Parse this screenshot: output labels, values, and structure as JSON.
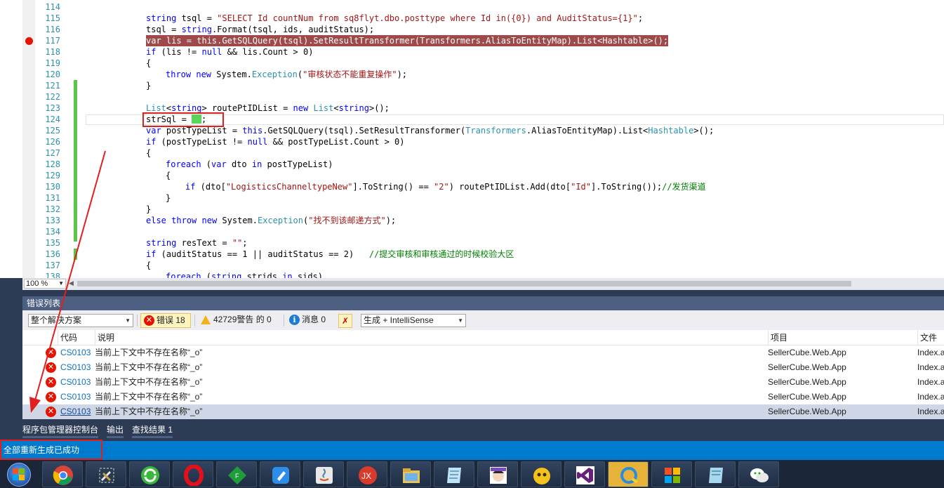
{
  "editor": {
    "line_numbers": [
      "114",
      "115",
      "116",
      "117",
      "118",
      "119",
      "120",
      "121",
      "122",
      "123",
      "124",
      "125",
      "126",
      "127",
      "128",
      "129",
      "130",
      "131",
      "132",
      "133",
      "134",
      "135",
      "136",
      "137",
      "138"
    ],
    "zoom": "100 %"
  },
  "code": {
    "l115": {
      "a": "string",
      "b": " tsql = ",
      "c": "\"SELECT Id countNum from sq8flyt.dbo.posttype where Id in({0}) and AuditStatus={1}\"",
      "d": ";"
    },
    "l116": {
      "a": "tsql = ",
      "b": "string",
      "c": ".Format(tsql, ids, auditStatus);"
    },
    "l117": "var lis = this.GetSQLQuery(tsql).SetResultTransformer(Transformers.AliasToEntityMap).List<Hashtable>();",
    "l118": {
      "a": "if",
      "b": " (lis != ",
      "c": "null",
      "d": " && lis.Count > 0)"
    },
    "l119": "{",
    "l120": {
      "a": "throw",
      "b": " ",
      "c": "new",
      "d": " System.",
      "e": "Exception",
      "f": "(",
      "g": "\"审核状态不能重复操作\"",
      "h": ");"
    },
    "l121": "}",
    "l123": {
      "a": "List",
      "b": "<",
      "c": "string",
      "d": "> routePtIDList = ",
      "e": "new",
      "f": " ",
      "g": "List",
      "h": "<",
      "i": "string",
      "j": ">();"
    },
    "l124": {
      "a": "strSql = ",
      "b": ";"
    },
    "l125": {
      "a": "var",
      "b": " postTypeList = ",
      "c": "this",
      "d": ".GetSQLQuery(tsql).SetResultTransformer(",
      "e": "Transformers",
      "f": ".AliasToEntityMap).List<",
      "g": "Hashtable",
      "h": ">();"
    },
    "l126": {
      "a": "if",
      "b": " (postTypeList != ",
      "c": "null",
      "d": " && postTypeList.Count > 0)"
    },
    "l127": "{",
    "l128": {
      "a": "foreach",
      "b": " (",
      "c": "var",
      "d": " dto ",
      "e": "in",
      "f": " postTypeList)"
    },
    "l129": "{",
    "l130": {
      "a": "if",
      "b": " (dto[",
      "c": "\"LogisticsChanneltypeNew\"",
      "d": "].ToString() == ",
      "e": "\"2\"",
      "f": ") routePtIDList.Add(dto[",
      "g": "\"Id\"",
      "h": "].ToString());",
      "i": "//发货渠道"
    },
    "l131": "}",
    "l132": "}",
    "l133": {
      "a": "else",
      "b": " ",
      "c": "throw",
      "d": " ",
      "e": "new",
      "f": " System.",
      "g": "Exception",
      "h": "(",
      "i": "\"找不到该邮递方式\"",
      "j": ");"
    },
    "l135": {
      "a": "string",
      "b": " resText = ",
      "c": "\"\"",
      "d": ";"
    },
    "l136": {
      "a": "if",
      "b": " (auditStatus == 1 || auditStatus == 2)   ",
      "c": "//提交审核和审核通过的时候校验大区"
    },
    "l137": "{",
    "l138": {
      "a": "foreach",
      "b": " (",
      "c": "string",
      "d": " strids ",
      "e": "in",
      "f": " sids)"
    }
  },
  "error_list": {
    "title": "错误列表",
    "scope": "整个解决方案",
    "errors_label": "错误 18",
    "warnings_label": "42729警告 的 0",
    "messages_label": "消息 0",
    "build_filter": "生成 + IntelliSense",
    "columns": {
      "code": "代码",
      "desc": "说明",
      "project": "项目",
      "file": "文件"
    },
    "rows": [
      {
        "code": "CS0103",
        "desc": "当前上下文中不存在名称“_o”",
        "project": "SellerCube.Web.App",
        "file": "Index.a"
      },
      {
        "code": "CS0103",
        "desc": "当前上下文中不存在名称“_o”",
        "project": "SellerCube.Web.App",
        "file": "Index.a"
      },
      {
        "code": "CS0103",
        "desc": "当前上下文中不存在名称“_o”",
        "project": "SellerCube.Web.App",
        "file": "Index.a"
      },
      {
        "code": "CS0103",
        "desc": "当前上下文中不存在名称“_o”",
        "project": "SellerCube.Web.App",
        "file": "Index.a"
      },
      {
        "code": "CS0103",
        "desc": "当前上下文中不存在名称“_o”",
        "project": "SellerCube.Web.App",
        "file": "Index.a"
      }
    ]
  },
  "tabs": [
    "程序包管理器控制台",
    "输出",
    "查找结果 1"
  ],
  "status": "全部重新生成已成功",
  "taskbar_apps": [
    "start-orb",
    "tools-icon",
    "chrome-icon",
    "refresh-app-icon",
    "opera-icon",
    "green-diamond-icon",
    "pen-note-icon",
    "java-icon",
    "jx-red-icon",
    "file-explorer-icon",
    "notepad-icon",
    "avatar-app-icon",
    "yellow-app-icon",
    "visual-studio-icon",
    "qq-browser-icon",
    "colored-blocks-icon",
    "notebook-icon",
    "wechat-icon"
  ],
  "colors": {
    "accent": "#007acc",
    "breakpoint": "#e51400",
    "annotation": "#e21f1f",
    "panel_title": "#4d6082"
  }
}
